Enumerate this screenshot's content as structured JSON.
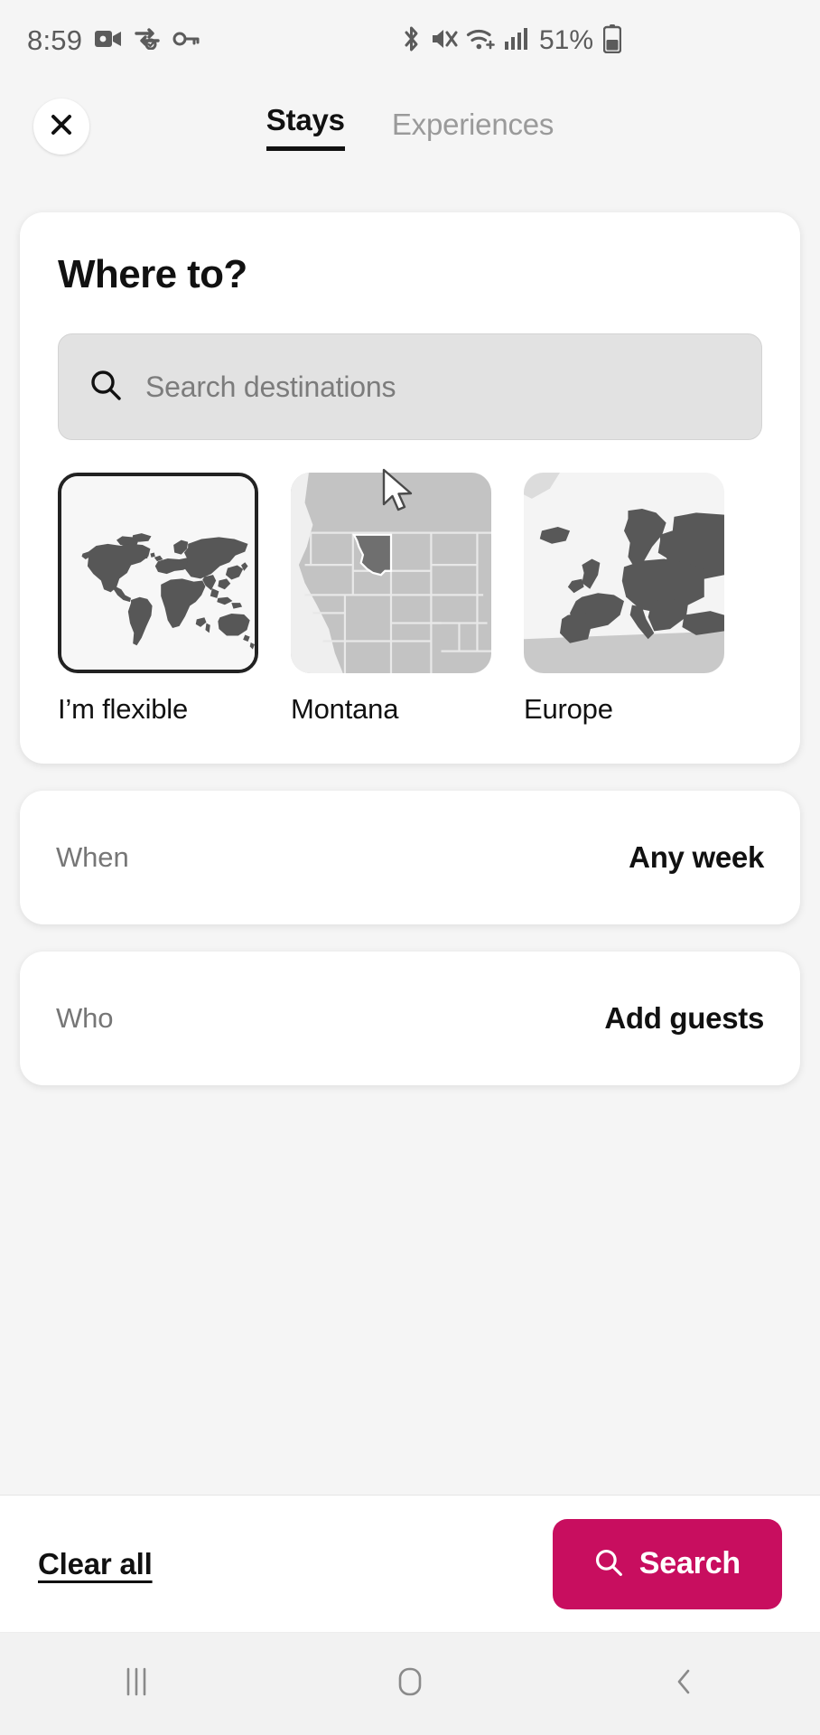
{
  "status_bar": {
    "time": "8:59",
    "left_icons": [
      "video-camera-icon",
      "data-saver-icon",
      "key-icon"
    ],
    "right_icons": [
      "bluetooth-icon",
      "mute-icon",
      "wifi-icon",
      "cellular-signal-icon"
    ],
    "battery_text": "51%"
  },
  "header": {
    "close_label": "×",
    "tabs": [
      {
        "label": "Stays",
        "active": true
      },
      {
        "label": "Experiences",
        "active": false
      }
    ]
  },
  "where_card": {
    "title": "Where to?",
    "search": {
      "value": "",
      "placeholder": "Search destinations",
      "icon": "search-icon"
    },
    "destinations": [
      {
        "label": "I’m flexible",
        "thumb": "world-map",
        "selected": true
      },
      {
        "label": "Montana",
        "thumb": "usa-montana-map",
        "selected": false
      },
      {
        "label": "Europe",
        "thumb": "europe-map",
        "selected": false
      }
    ]
  },
  "when_row": {
    "label": "When",
    "value": "Any week"
  },
  "who_row": {
    "label": "Who",
    "value": "Add guests"
  },
  "footer": {
    "clear_all_label": "Clear all",
    "search_label": "Search",
    "search_icon": "search-icon",
    "accent_color": "#C80E5F"
  },
  "nav_bar": {
    "recents_label": "|||",
    "home_label": "home-icon",
    "back_label": "back-icon"
  }
}
